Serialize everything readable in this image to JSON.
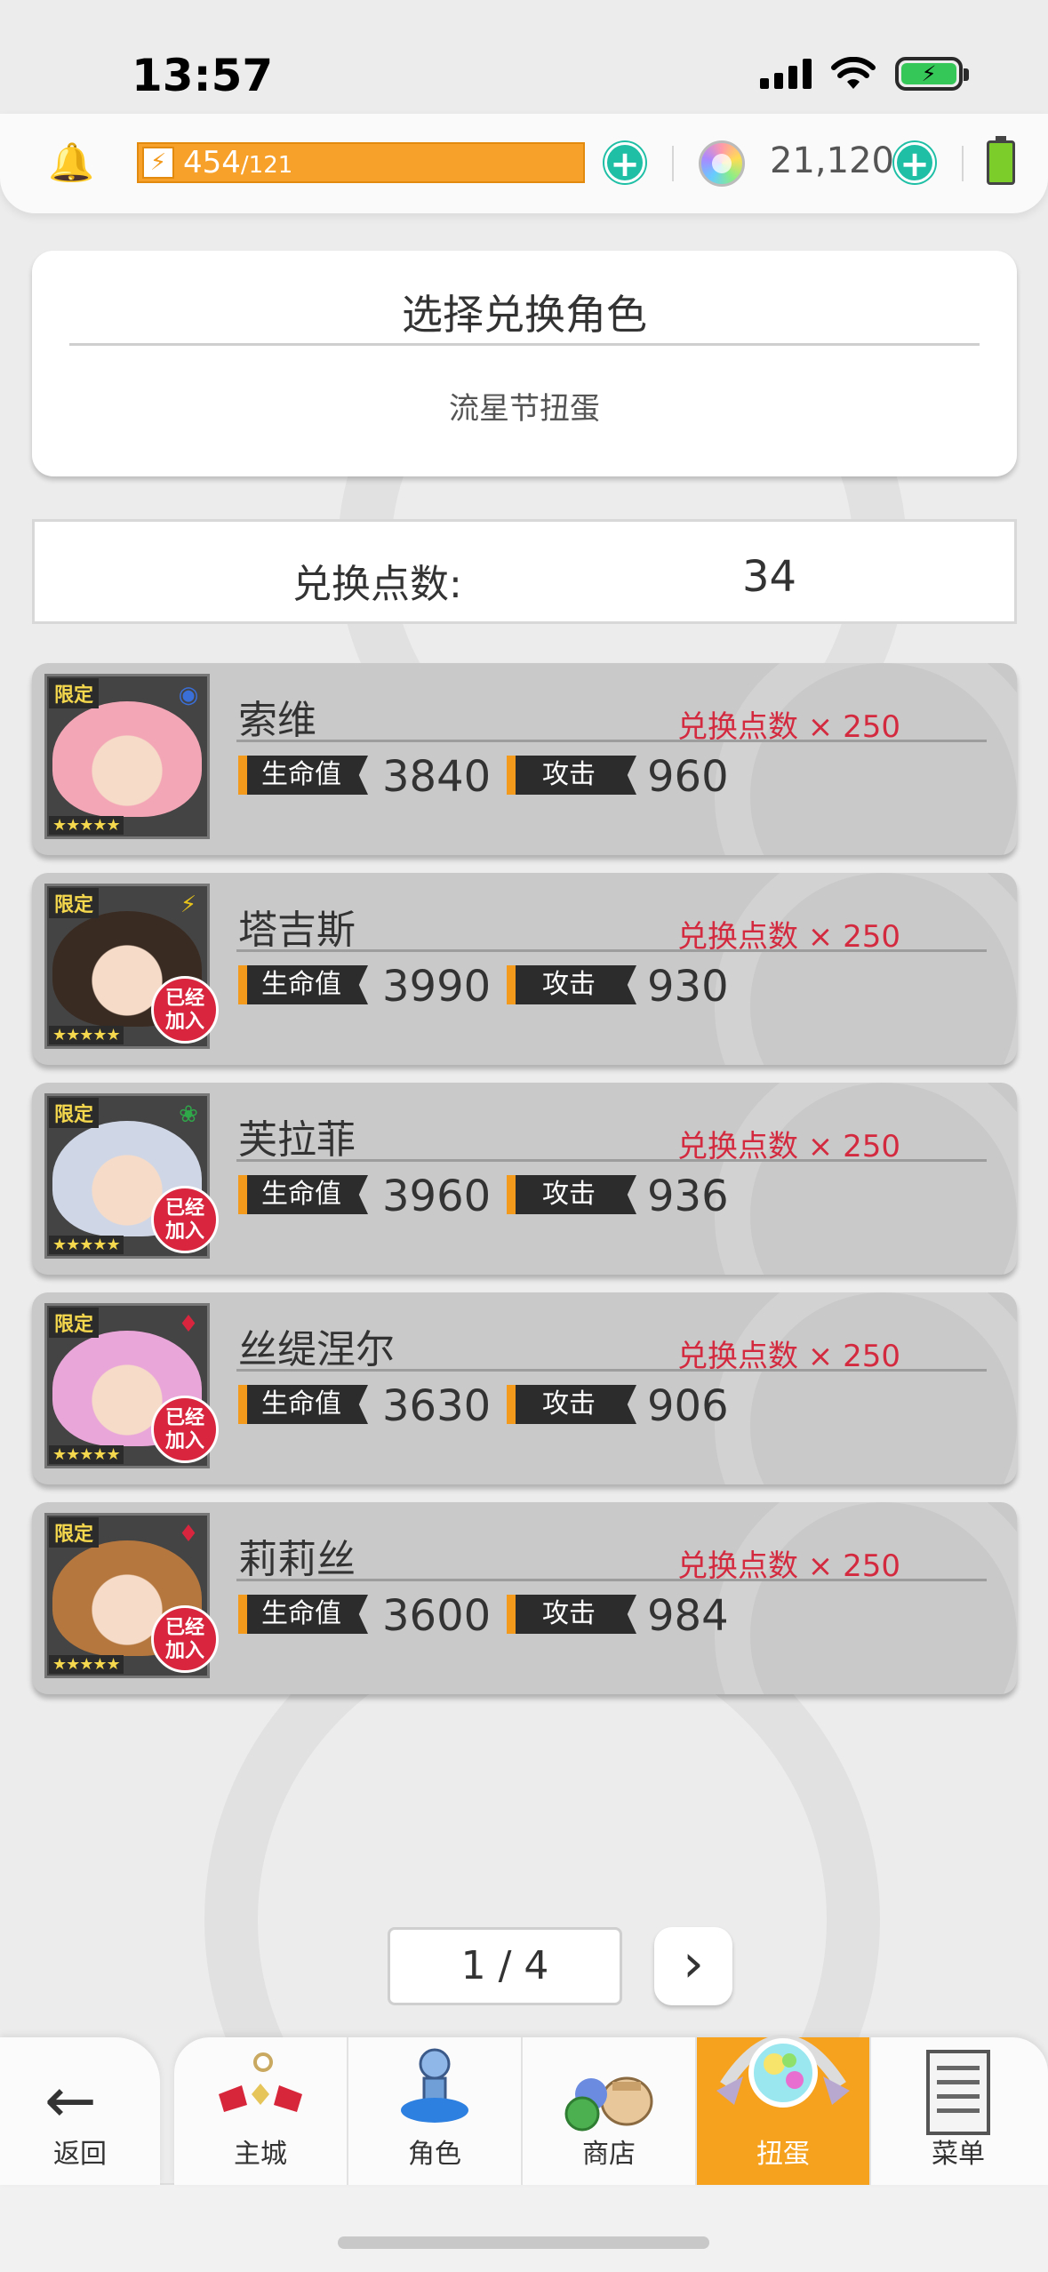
{
  "status_bar": {
    "time": "13:57"
  },
  "resources": {
    "stamina_current": "454",
    "stamina_max": "/121",
    "gems": "21,120"
  },
  "header": {
    "title": "选择兑换角色",
    "subtitle": "流星节扭蛋"
  },
  "points": {
    "label": "兑换点数:",
    "value": "34"
  },
  "stat_labels": {
    "hp": "生命值",
    "atk": "攻击"
  },
  "badges": {
    "limited": "限定",
    "stars": "★★★★★",
    "joined": "已经\n加入"
  },
  "characters": [
    {
      "name": "索维",
      "cost": "兑换点数 × 250",
      "hp": "3840",
      "atk": "960",
      "element": "blue",
      "joined": false,
      "element_color": "#3a6fd8",
      "hair_color": "#f3a6b6"
    },
    {
      "name": "塔吉斯",
      "cost": "兑换点数 × 250",
      "hp": "3990",
      "atk": "930",
      "element": "lightning",
      "joined": true,
      "element_color": "#e6c21a",
      "hair_color": "#3a2b22"
    },
    {
      "name": "芙拉菲",
      "cost": "兑换点数 × 250",
      "hp": "3960",
      "atk": "936",
      "element": "wind",
      "joined": true,
      "element_color": "#2fa84a",
      "hair_color": "#cfd6e6"
    },
    {
      "name": "丝缇涅尔",
      "cost": "兑换点数 × 250",
      "hp": "3630",
      "atk": "906",
      "element": "fire",
      "joined": true,
      "element_color": "#d9263e",
      "hair_color": "#e9a6d8"
    },
    {
      "name": "莉莉丝",
      "cost": "兑换点数 × 250",
      "hp": "3600",
      "atk": "984",
      "element": "fire",
      "joined": true,
      "element_color": "#d9263e",
      "hair_color": "#b5773e"
    }
  ],
  "pager": {
    "text": "1 / 4"
  },
  "nav": {
    "back_label": "返回",
    "items": [
      {
        "label": "主城",
        "icon": "castle-icon",
        "active": false
      },
      {
        "label": "角色",
        "icon": "character-icon",
        "active": false
      },
      {
        "label": "商店",
        "icon": "shop-icon",
        "active": false
      },
      {
        "label": "扭蛋",
        "icon": "gacha-icon",
        "active": true
      },
      {
        "label": "菜单",
        "icon": "menu-icon",
        "active": false
      }
    ]
  },
  "colors": {
    "accent": "#f6a21e",
    "cost_red": "#d42a3f",
    "plus_teal": "#1fbfa6"
  }
}
